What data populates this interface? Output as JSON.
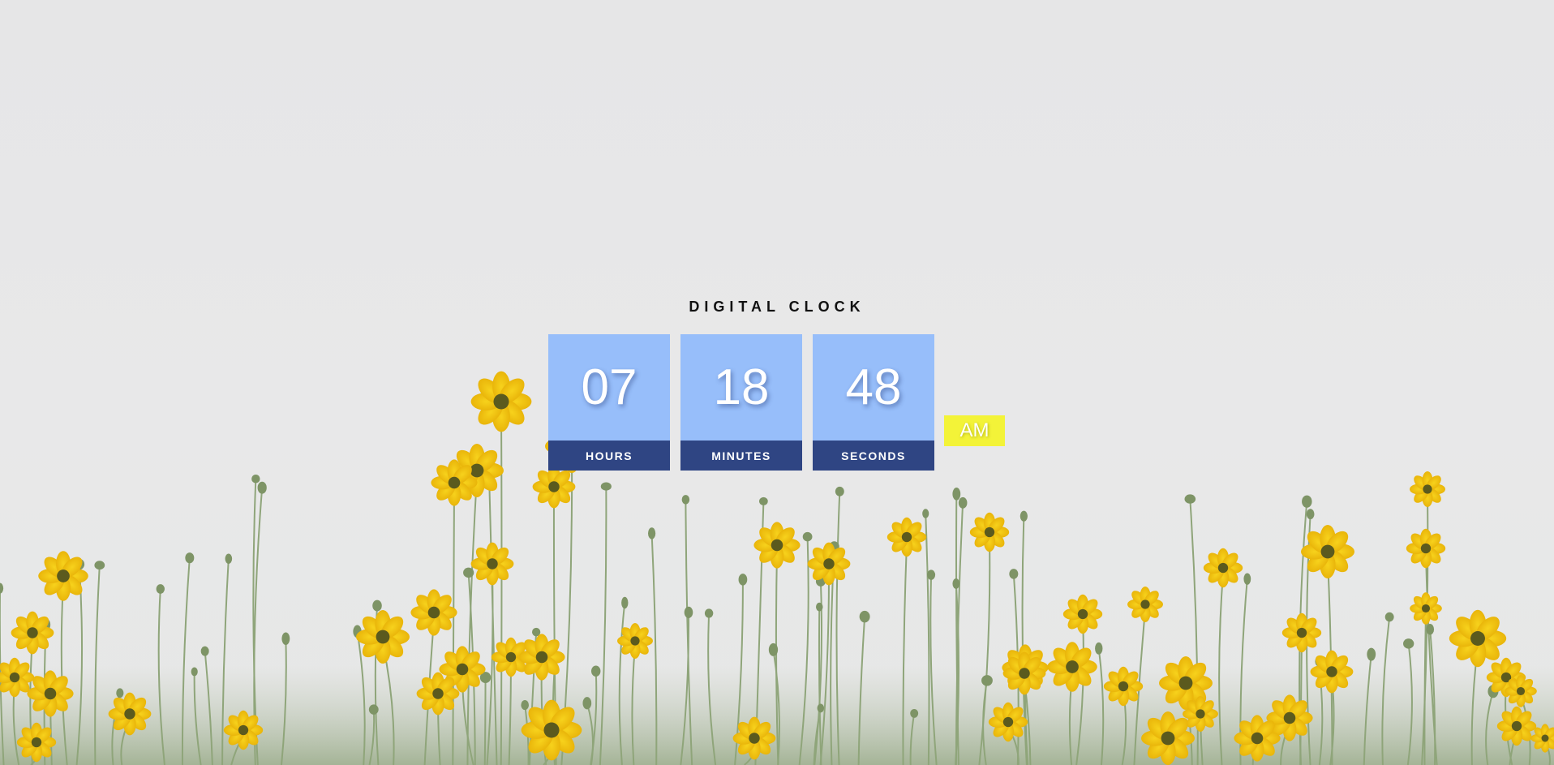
{
  "title": "DIGITAL CLOCK",
  "clock": {
    "hours": "07",
    "minutes": "18",
    "seconds": "48",
    "hours_label": "HOURS",
    "minutes_label": "MINUTES",
    "seconds_label": "SECONDS",
    "period": "AM"
  },
  "background": {
    "subject": "yellow-flower-meadow",
    "sky_color": "#e7e7e8"
  },
  "colors": {
    "tile_digit_bg": "#97befa",
    "tile_label_bg": "#2f4583",
    "period_bg": "#f3f338"
  }
}
